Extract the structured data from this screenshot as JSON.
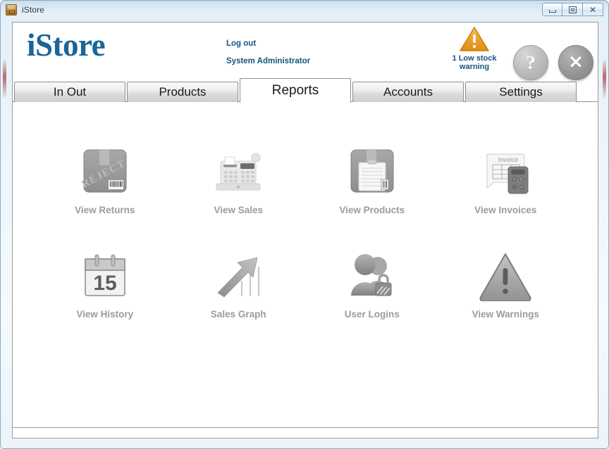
{
  "window": {
    "title": "iStore",
    "app_icon": "box-icon",
    "controls": [
      {
        "name": "minimize",
        "icon": "minimize-icon"
      },
      {
        "name": "maximize",
        "icon": "maximize-icon"
      },
      {
        "name": "close",
        "icon": "close-icon",
        "glyph": "✕"
      }
    ]
  },
  "header": {
    "brand": "iStore",
    "brand_color": "#1a6597",
    "logout_label": "Log out",
    "user_name": "System Administrator",
    "link_color": "#15537f",
    "warning": {
      "icon": "warning-triangle-icon",
      "label": "1 Low stock warning",
      "count": 1,
      "color": "#f0a32e"
    },
    "help_button": {
      "icon": "question-mark-icon",
      "glyph": "?"
    },
    "close_button": {
      "icon": "close-x-icon",
      "glyph": "✕"
    }
  },
  "tabs": [
    {
      "label": "In Out",
      "active": false
    },
    {
      "label": "Products",
      "active": false
    },
    {
      "label": "Reports",
      "active": true
    },
    {
      "label": "Accounts",
      "active": false
    },
    {
      "label": "Settings",
      "active": false
    }
  ],
  "reports": [
    {
      "label": "View Returns",
      "icon": "reject-box-icon"
    },
    {
      "label": "View Sales",
      "icon": "cash-register-icon"
    },
    {
      "label": "View Products",
      "icon": "clipboard-box-icon"
    },
    {
      "label": "View Invoices",
      "icon": "invoice-calculator-icon"
    },
    {
      "label": "View History",
      "icon": "calendar-icon",
      "calendar_day": "15"
    },
    {
      "label": "Sales Graph",
      "icon": "growth-arrow-icon"
    },
    {
      "label": "User Logins",
      "icon": "users-lock-icon"
    },
    {
      "label": "View Warnings",
      "icon": "warning-triangle-gray-icon"
    }
  ],
  "icon_art": {
    "reject_stamp_text": "REJECT",
    "invoice_caption": "Invoice"
  }
}
